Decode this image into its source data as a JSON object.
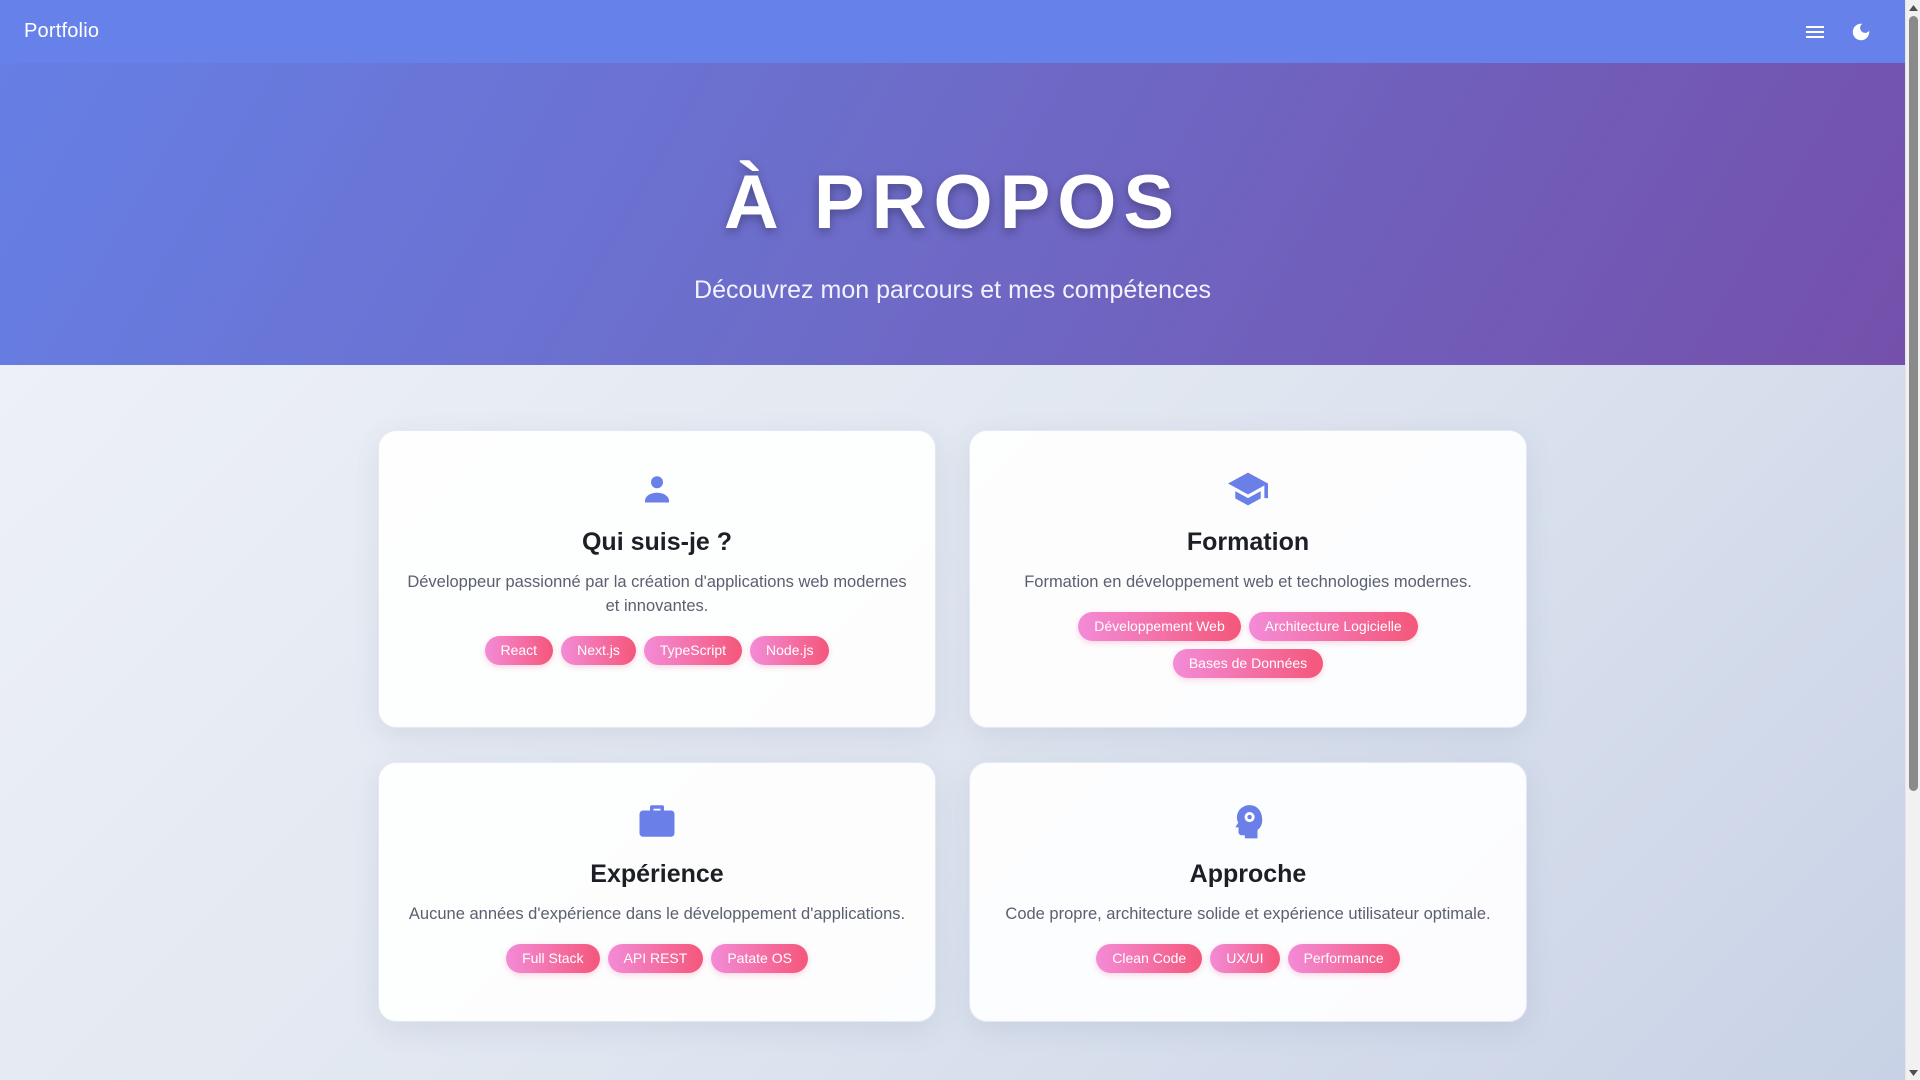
{
  "navbar": {
    "brand": "Portfolio",
    "menu_icon": "hamburger-menu-icon",
    "theme_icon": "moon-icon",
    "background": "#6681ea"
  },
  "hero": {
    "title": "À PROPOS",
    "subtitle": "Découvrez mon parcours et mes compétences"
  },
  "cards": [
    {
      "icon": "person-icon",
      "title": "Qui suis-je ?",
      "text": "Développeur passionné par la création d'applications web modernes et innovantes.",
      "tags": [
        "React",
        "Next.js",
        "TypeScript",
        "Node.js"
      ]
    },
    {
      "icon": "graduation-cap-icon",
      "title": "Formation",
      "text": "Formation en développement web et technologies modernes.",
      "tags": [
        "Développement Web",
        "Architecture Logicielle",
        "Bases de Données"
      ]
    },
    {
      "icon": "briefcase-icon",
      "title": "Expérience",
      "text": "Aucune années d'expérience dans le développement d'applications.",
      "tags": [
        "Full Stack",
        "API REST",
        "Patate OS"
      ]
    },
    {
      "icon": "head-gear-icon",
      "title": "Approche",
      "text": "Code propre, architecture solide et expérience utilisateur optimale.",
      "tags": [
        "Clean Code",
        "UX/UI",
        "Performance"
      ]
    }
  ],
  "colors": {
    "accent": "#6681ea",
    "icon": "#6a80e8",
    "tag_start": "#f38bd7",
    "tag_end": "#f4577a"
  }
}
